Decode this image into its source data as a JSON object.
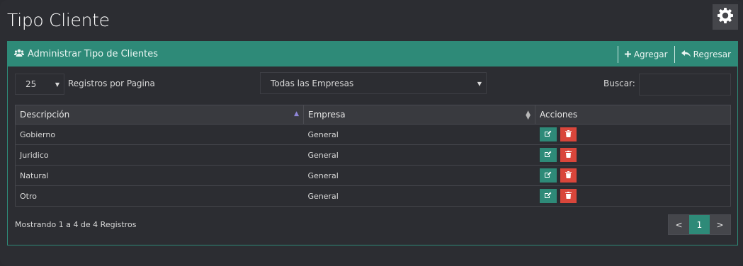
{
  "page": {
    "title": "Tipo Cliente"
  },
  "panel": {
    "title": "Administrar Tipo de Clientes",
    "actions": {
      "add_label": "Agregar",
      "back_label": "Regresar"
    }
  },
  "controls": {
    "page_length": "25",
    "page_length_label": "Registros por Pagina",
    "empresa_filter": "Todas las Empresas",
    "search_label": "Buscar:",
    "search_value": ""
  },
  "table": {
    "headers": [
      "Descripción",
      "Empresa",
      "Acciones"
    ],
    "rows": [
      {
        "descripcion": "Gobierno",
        "empresa": "General"
      },
      {
        "descripcion": "Juridico",
        "empresa": "General"
      },
      {
        "descripcion": "Natural",
        "empresa": "General"
      },
      {
        "descripcion": "Otro",
        "empresa": "General"
      }
    ]
  },
  "footer": {
    "info": "Mostrando 1 a 4 de 4 Registros",
    "pagination": {
      "prev": "<",
      "current": "1",
      "next": ">"
    }
  },
  "icons": {
    "settings": "gear-icon",
    "users": "users-icon",
    "add": "plus-icon",
    "back": "reply-icon",
    "edit": "edit-icon",
    "delete": "trash-icon"
  },
  "colors": {
    "accent": "#2e8a78",
    "danger": "#d9463b",
    "background": "#2c2d32"
  }
}
